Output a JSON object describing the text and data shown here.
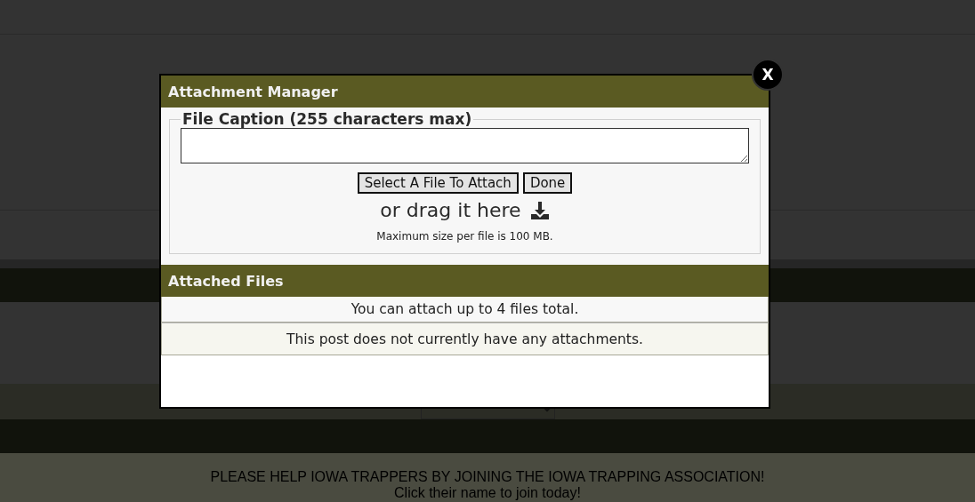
{
  "background": {
    "banner": [
      "PLEASE HELP IOWA TRAPPERS BY JOINING THE IOWA TRAPPING ASSOCIATION!",
      "Click their name to join today!"
    ]
  },
  "modal": {
    "close": "X",
    "title": "Attachment Manager",
    "caption": {
      "legend": "File Caption (255 characters max)"
    },
    "buttons": [
      "Select A File To Attach",
      "Done"
    ],
    "drag_text": "or drag it here",
    "max_size": "Maximum size per file is 100 MB.",
    "attached": {
      "title": "Attached Files",
      "rows": [
        "You can attach up to 4 files total.",
        "This post does not currently have any attachments."
      ]
    }
  }
}
